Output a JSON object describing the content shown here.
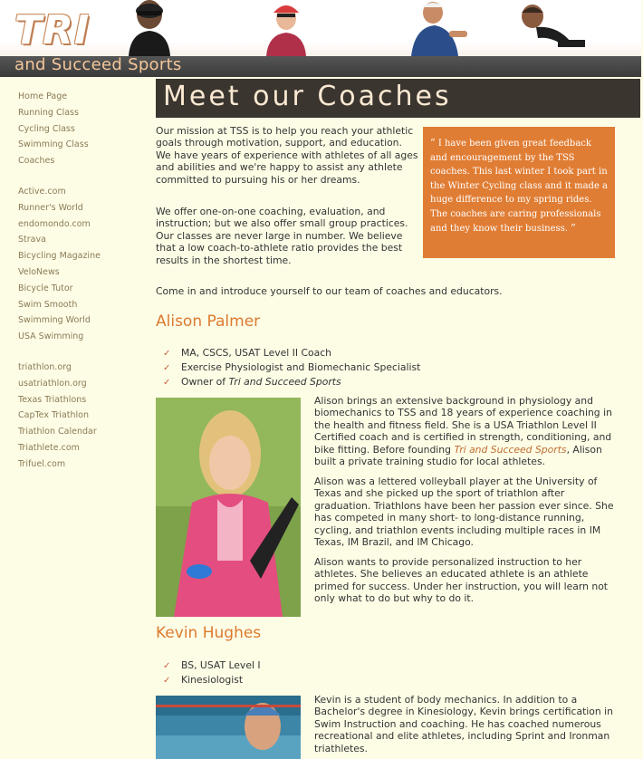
{
  "banner": {
    "logo_main": "TRI",
    "logo_sub": "and Succeed Sports"
  },
  "sidebar": {
    "groups": [
      [
        "Home Page",
        "Running Class",
        "Cycling Class",
        "Swimming Class",
        "Coaches"
      ],
      [
        "Active.com",
        "Runner's World",
        "endomondo.com",
        "Strava",
        "Bicycling Magazine",
        "VeloNews",
        "Bicycle Tutor",
        "Swim Smooth",
        "Swimming World",
        "USA Swimming"
      ],
      [
        "triathlon.org",
        "usatriathlon.org",
        "Texas Triathlons",
        "CapTex Triathlon",
        "Triathlon Calendar",
        "Triathlete.com",
        "Trifuel.com"
      ]
    ]
  },
  "page": {
    "title": "Meet our Coaches",
    "intro": [
      "Our mission at TSS is to help you reach your athletic goals through motivation, support, and education. We have years of experience with athletes of all ages and abilities and we're happy to assist any athlete committed to pursuing his or her dreams.",
      "We offer one-on-one coaching, evaluation, and instruction; but we also offer small group practices. Our classes are never large in number. We believe that a low coach-to-athlete ratio provides the best results in the shortest time."
    ],
    "invite": "Come in and introduce yourself to our team of coaches and educators."
  },
  "quote": {
    "open": "“",
    "text": "I have been given great feedback and encouragement by the TSS coaches. This last winter I took part in the Winter Cycling class and it made a huge difference to my spring rides. The coaches are caring professionals and they know their business.",
    "close": "”"
  },
  "coaches": [
    {
      "name": "Alison Palmer",
      "creds": [
        "MA, CSCS, USAT Level II Coach",
        "Exercise Physiologist and Biomechanic Specialist"
      ],
      "owner_prefix": "Owner of ",
      "owner_company": "Tri and Succeed Sports",
      "bio1_a": "Alison brings an extensive background in physiology and biomechanics to TSS and 18 years of experience coaching in the health and fitness field. She is a USA Triathlon Level II Certified coach and is certified in strength, conditioning, and bike fitting. Before founding ",
      "bio1_em": "Tri and Succeed Sports",
      "bio1_b": ", Alison built a private training studio for local athletes.",
      "bio2": "Alison was a lettered volleyball player at the University of Texas and she picked up the sport of triathlon after graduation. Triathlons have been her passion ever since. She has competed in many short- to long-distance running, cycling, and triathlon events including multiple races in IM Texas, IM Brazil, and IM Chicago.",
      "bio3": "Alison wants to provide personalized instruction to her athletes. She believes an educated athlete is an athlete primed for success. Under her instruction, you will learn not only what to do but why to do it."
    },
    {
      "name": "Kevin Hughes",
      "creds": [
        "BS, USAT Level I",
        "Kinesiologist"
      ],
      "bio1": "Kevin is a student of body mechanics. In addition to a Bachelor's degree in Kinesiology, Kevin brings certification in Swim Instruction and coaching. He has coached numerous recreational and elite athletes, including Sprint and Ironman triathletes."
    }
  ],
  "icons": {
    "check": "✓"
  },
  "colors": {
    "accent": "#dc7a2f",
    "quote_bg": "#e07d34",
    "title_bar": "#3b3530",
    "page_bg": "#fdfde6"
  }
}
